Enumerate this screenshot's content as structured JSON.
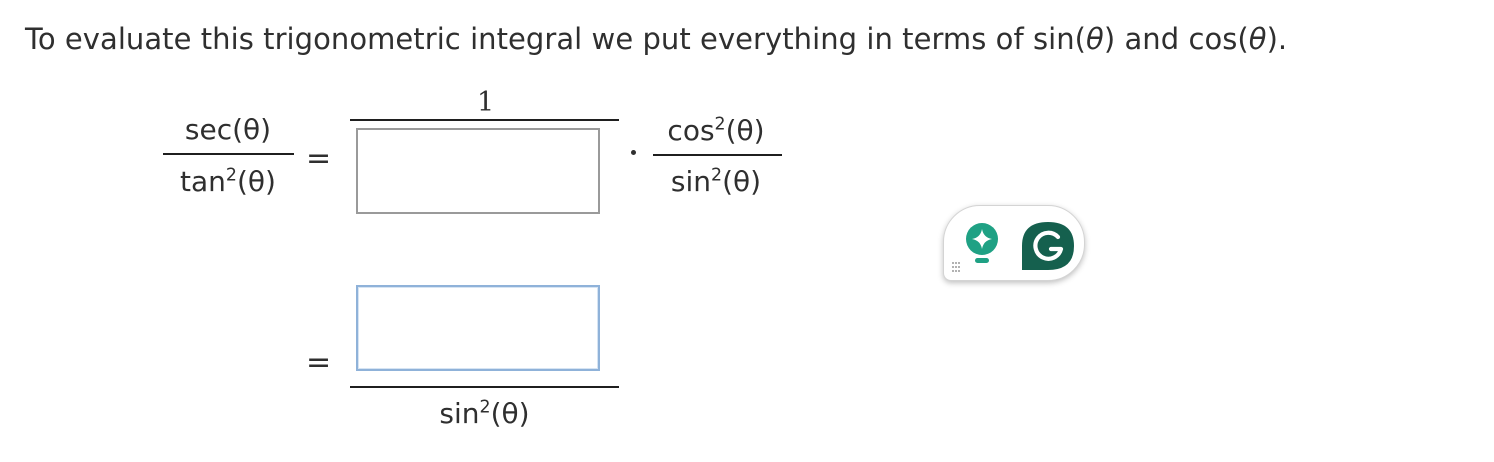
{
  "intro": {
    "prefix": "To evaluate this trigonometric integral we put everything in terms of sin(",
    "middle": ") and cos(",
    "suffix": ").",
    "theta": "θ"
  },
  "equation": {
    "lhs": {
      "numerator": "sec(θ)",
      "den_fn": "tan",
      "den_exp": "2",
      "den_arg": "(θ)"
    },
    "equals": "=",
    "first_fraction": {
      "numerator": "1",
      "answer_value": ""
    },
    "second_fraction": {
      "num_fn": "cos",
      "num_exp": "2",
      "num_arg": "(θ)",
      "den_fn": "sin",
      "den_exp": "2",
      "den_arg": "(θ)"
    },
    "result": {
      "answer_value": "",
      "den_fn": "sin",
      "den_exp": "2",
      "den_arg": "(θ)"
    }
  },
  "grammarly": {
    "bulb_icon": "lightbulb-sparkle-icon",
    "logo_icon": "grammarly-g-icon",
    "brand_color": "#15604e",
    "bulb_color": "#1fa184"
  }
}
